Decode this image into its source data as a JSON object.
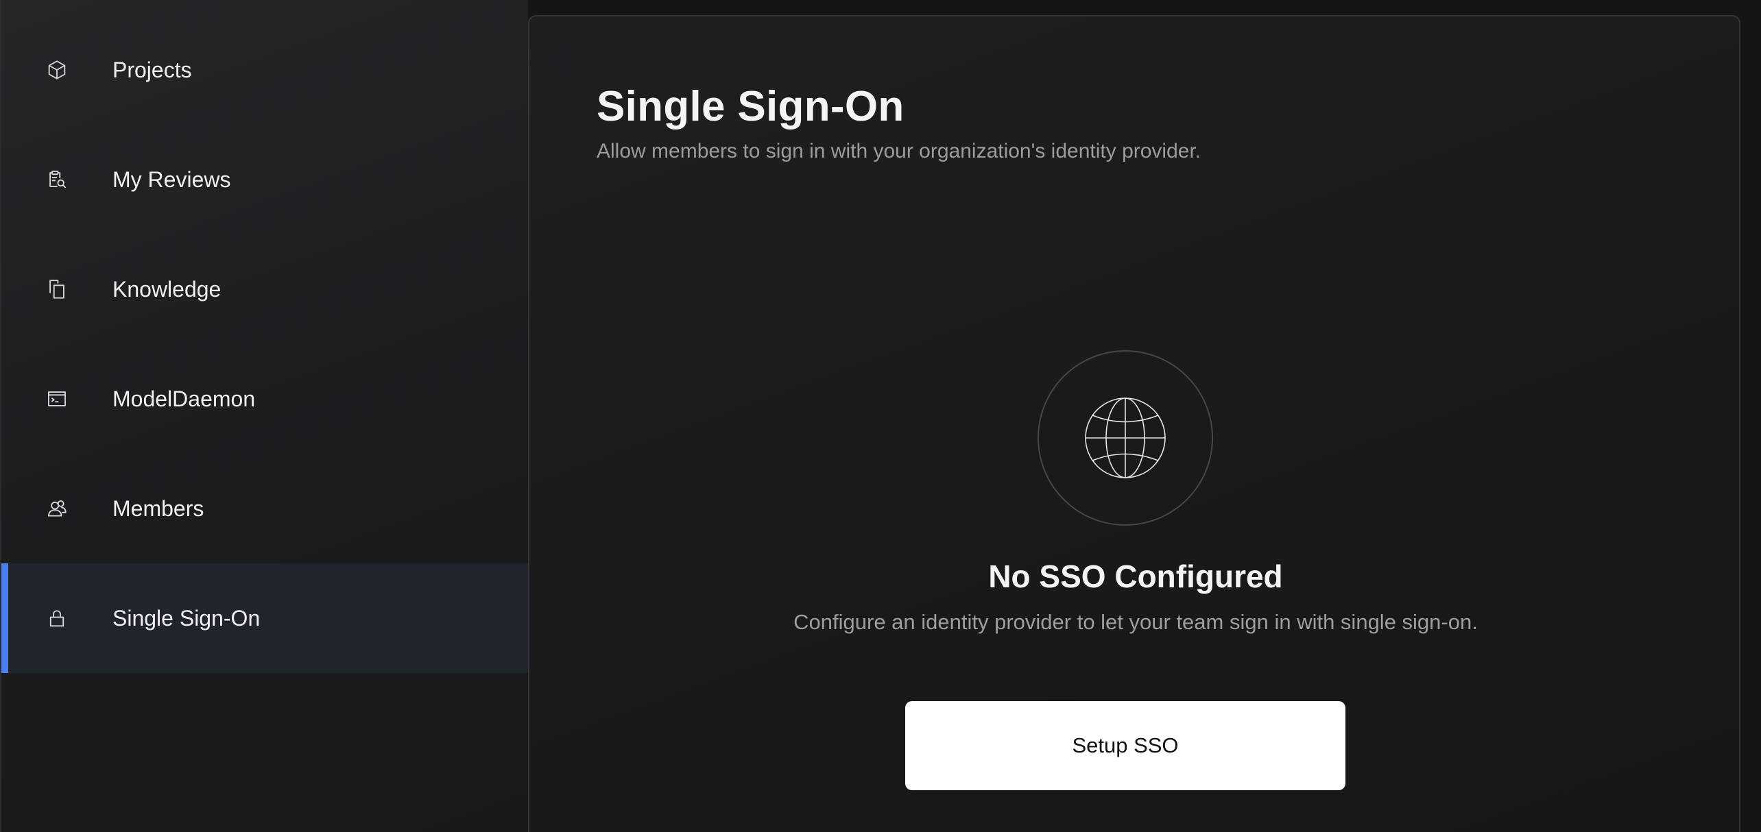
{
  "sidebar": {
    "items": [
      {
        "label": "Projects",
        "icon": "cube-icon"
      },
      {
        "label": "My Reviews",
        "icon": "review-clipboard-icon"
      },
      {
        "label": "Knowledge",
        "icon": "documents-icon"
      },
      {
        "label": "ModelDaemon",
        "icon": "terminal-window-icon"
      },
      {
        "label": "Members",
        "icon": "users-icon"
      },
      {
        "label": "Single Sign-On",
        "icon": "lock-icon",
        "active": true
      }
    ],
    "accent_color": "#4a7ff0"
  },
  "main": {
    "title": "Single Sign-On",
    "subtitle": "Allow members to sign in with your organization's identity provider.",
    "empty_state": {
      "icon": "globe-icon",
      "title": "No SSO Configured",
      "description": "Configure an identity provider to let your team sign in with single sign-on.",
      "button_label": "Setup SSO"
    }
  }
}
